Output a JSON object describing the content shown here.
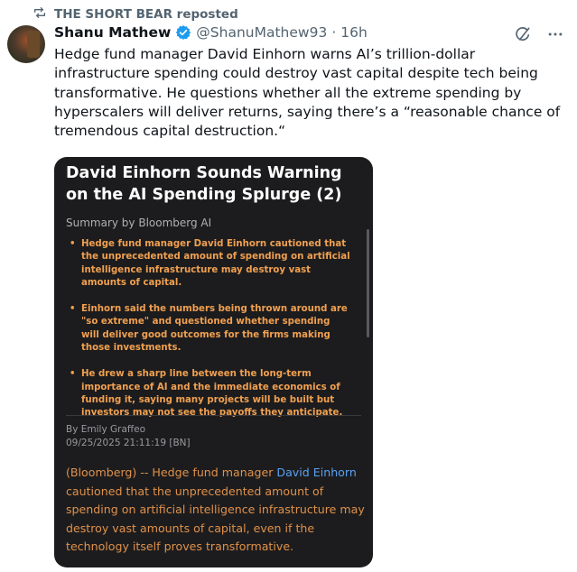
{
  "repost": {
    "label": "THE SHORT BEAR reposted"
  },
  "author": {
    "name": "Shanu Mathew",
    "handle": "@ShanuMathew93",
    "separator": "·",
    "time": "16h"
  },
  "tweet": {
    "text": "Hedge fund manager David Einhorn warns AI’s trillion-dollar infrastructure spending could destroy vast capital despite tech being transformative. He questions whether all the extreme spending by hyperscalers will deliver returns, saying there’s a “reasonable chance of tremendous capital destruction.“"
  },
  "card": {
    "title": "David Einhorn Sounds Warning on the AI Spending Splurge (2)",
    "summary_label": "Summary by Bloomberg AI",
    "bullets": [
      "Hedge fund manager David Einhorn cautioned that the unprecedented amount of spending on artificial intelligence infrastructure may destroy vast amounts of capital.",
      "Einhorn said the numbers being thrown around are \"so extreme\" and questioned whether spending will deliver good outcomes for the firms making those investments.",
      "He drew a sharp line between the long-term importance of AI and the immediate economics of funding it, saying many projects will be built but investors may not see the payoffs they anticipate."
    ],
    "byline": "By Emily Graffeo",
    "timestamp": "09/25/2025 21:11:19 [BN]",
    "article_prefix": "(Bloomberg) -- Hedge fund manager ",
    "article_link": "David Einhorn",
    "article_suffix": " cautioned that the unprecedented amount of spending on artificial intelligence infrastructure may destroy vast amounts of capital, even if the technology itself proves transformative."
  },
  "colors": {
    "card_bg": "#1c1c1e",
    "accent_orange": "#f0a050",
    "link_blue": "#5aa0f0",
    "verified_blue": "#1d9bf0"
  },
  "icons": [
    "repost-icon",
    "verified-badge-icon",
    "grok-icon",
    "more-icon"
  ]
}
